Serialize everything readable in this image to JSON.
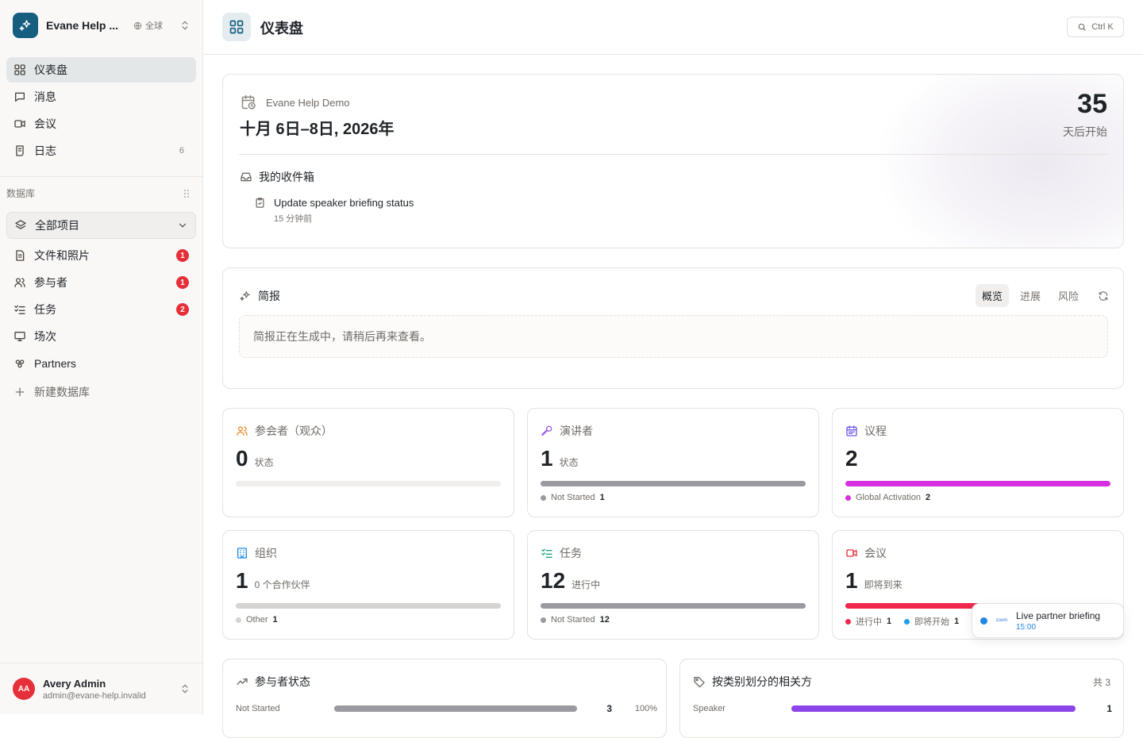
{
  "workspace": {
    "name": "Evane Help ...",
    "scope": "全球"
  },
  "nav": [
    {
      "label": "仪表盘",
      "count": "",
      "active": true
    },
    {
      "label": "消息",
      "count": ""
    },
    {
      "label": "会议",
      "count": ""
    },
    {
      "label": "日志",
      "count": "6"
    }
  ],
  "database": {
    "title": "数据库",
    "all_projects": "全部项目",
    "items": [
      {
        "label": "文件和照片",
        "badge": "1"
      },
      {
        "label": "参与者",
        "badge": "1"
      },
      {
        "label": "任务",
        "badge": "2"
      },
      {
        "label": "场次",
        "badge": ""
      },
      {
        "label": "Partners",
        "badge": ""
      }
    ],
    "new_db": "新建数据库"
  },
  "user": {
    "initials": "AA",
    "name": "Avery Admin",
    "email": "admin@evane-help.invalid"
  },
  "header": {
    "title": "仪表盘",
    "search_shortcut": "Ctrl K"
  },
  "event": {
    "org": "Evane Help Demo",
    "dates": "十月 6日–8日, 2026年",
    "days_until": "35",
    "days_caption": "天后开始",
    "inbox_title": "我的收件箱",
    "inbox_item": {
      "title": "Update speaker briefing status",
      "time": "15 分钟前"
    }
  },
  "briefing": {
    "title": "简报",
    "tabs": [
      "概览",
      "进展",
      "风险"
    ],
    "active_tab": "概览",
    "placeholder": "简报正在生成中，请稍后再来查看。"
  },
  "stats": {
    "attendees": {
      "title": "参会者（观众）",
      "value": "0",
      "unit": "状态",
      "color": "#e8892b"
    },
    "speakers": {
      "title": "演讲者",
      "value": "1",
      "unit": "状态",
      "legend": "Not Started",
      "legend_value": "1",
      "color": "#9b5de5",
      "bar_color": "#9b9aa0"
    },
    "agenda": {
      "title": "议程",
      "value": "2",
      "unit": "",
      "legend": "Global Activation",
      "legend_value": "2",
      "color": "#6b5ce7",
      "bar_color": "#d62fe0"
    },
    "orgs": {
      "title": "组织",
      "value": "1",
      "unit": "0 个合作伙伴",
      "legend": "Other",
      "legend_value": "1",
      "color": "#1e88e5",
      "bar_color": "#d6d4d2"
    },
    "tasks": {
      "title": "任务",
      "value": "12",
      "unit": "进行中",
      "legend": "Not Started",
      "legend_value": "12",
      "color": "#16a37f",
      "bar_color": "#9b9aa0"
    },
    "meetings": {
      "title": "会议",
      "value": "1",
      "unit": "即将到来",
      "legend_a": "进行中",
      "legend_a_value": "1",
      "legend_b": "即将开始",
      "legend_b_value": "1",
      "color": "#e5303a",
      "bar_a": "#f0294d",
      "bar_b": "#1ea0f0"
    }
  },
  "live": {
    "provider": "zoom",
    "title": "Live partner briefing",
    "time": "15:00"
  },
  "participant_status": {
    "title": "参与者状态",
    "rows": [
      {
        "label": "Not Started",
        "value": "3",
        "percent": "100%",
        "fraction": 1.0
      }
    ]
  },
  "stakeholders": {
    "title": "按类别划分的相关方",
    "total": "共 3",
    "rows": [
      {
        "label": "Speaker",
        "value": "1",
        "fraction": 1.0
      }
    ]
  }
}
